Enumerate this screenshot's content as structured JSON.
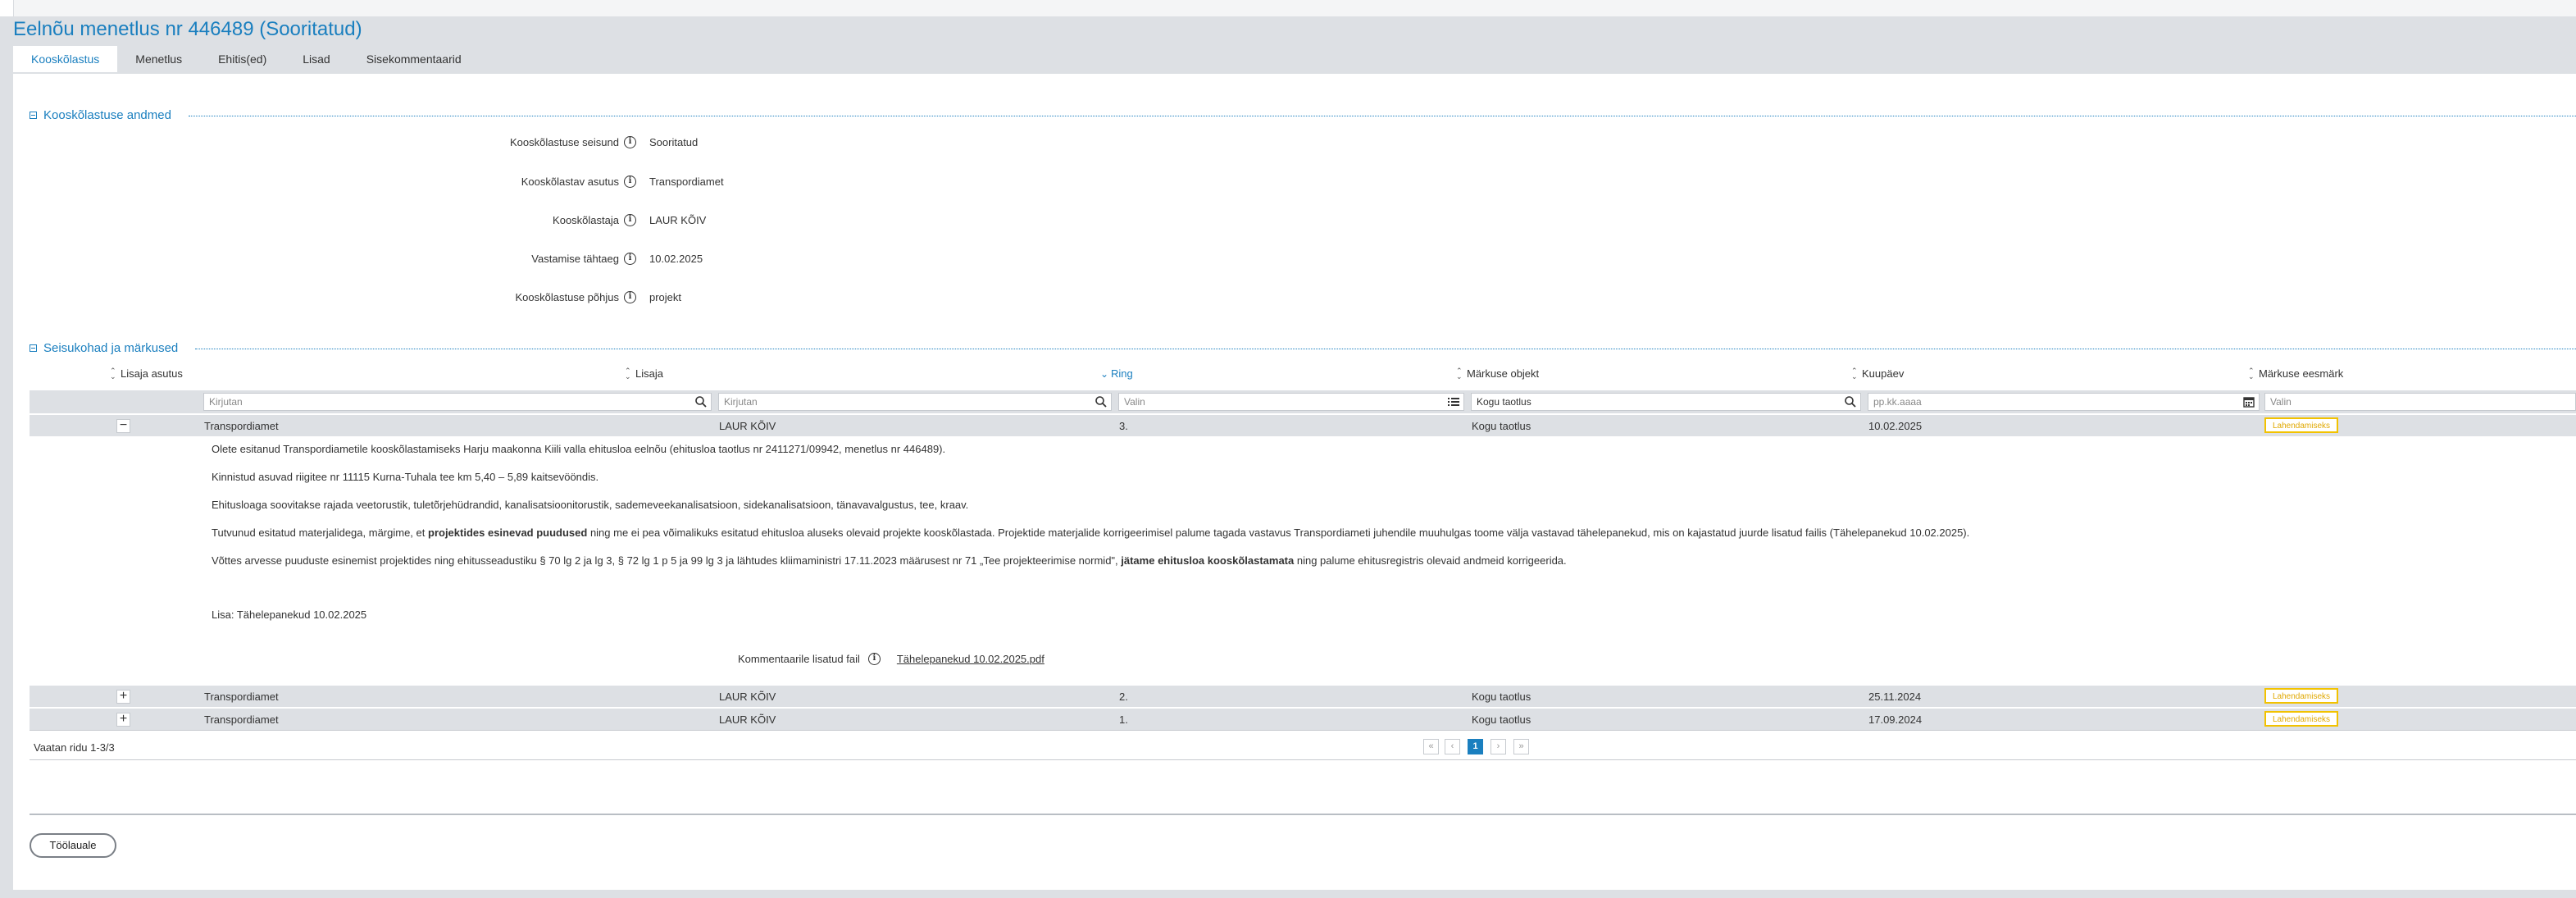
{
  "page": {
    "title": "Eelnõu menetlus nr 446489 (Sooritatud)"
  },
  "tabs": [
    {
      "label": "Kooskõlastus",
      "active": true
    },
    {
      "label": "Menetlus"
    },
    {
      "label": "Ehitis(ed)"
    },
    {
      "label": "Lisad"
    },
    {
      "label": "Sisekommentaarid"
    }
  ],
  "sections": {
    "approval_data_title": "Kooskõlastuse andmed",
    "comments_title": "Seisukohad ja märkused"
  },
  "approval_fields": [
    {
      "label": "Kooskõlastuse seisund",
      "value": "Sooritatud"
    },
    {
      "label": "Kooskõlastav asutus",
      "value": "Transpordiamet"
    },
    {
      "label": "Kooskõlastaja",
      "value": "LAUR KÕIV"
    },
    {
      "label": "Vastamise tähtaeg",
      "value": "10.02.2025"
    },
    {
      "label": "Kooskõlastuse põhjus",
      "value": "projekt"
    }
  ],
  "grid": {
    "columns": [
      "Lisaja asutus",
      "Lisaja",
      "Ring",
      "Märkuse objekt",
      "Kuupäev",
      "Märkuse eesmärk"
    ],
    "filters": {
      "agency_placeholder": "Kirjutan",
      "adder_placeholder": "Kirjutan",
      "round_placeholder": "Valin",
      "object_value": "Kogu taotlus",
      "date_placeholder": "pp.kk.aaaa",
      "purpose_placeholder": "Valin"
    },
    "rows": [
      {
        "agency": "Transpordiamet",
        "adder": "LAUR KÕIV",
        "round": "3.",
        "object": "Kogu taotlus",
        "date": "10.02.2025",
        "purpose": "Lahendamiseks",
        "toggle": "−"
      },
      {
        "agency": "Transpordiamet",
        "adder": "LAUR KÕIV",
        "round": "2.",
        "object": "Kogu taotlus",
        "date": "25.11.2024",
        "purpose": "Lahendamiseks",
        "toggle": "+"
      },
      {
        "agency": "Transpordiamet",
        "adder": "LAUR KÕIV",
        "round": "1.",
        "object": "Kogu taotlus",
        "date": "17.09.2024",
        "purpose": "Lahendamiseks",
        "toggle": "+"
      }
    ],
    "detail": {
      "p1": "Olete esitanud Transpordiametile kooskõlastamiseks Harju maakonna Kiili valla ehitusloa eelnõu (ehitusloa taotlus nr 2411271/09942, menetlus nr 446489).",
      "p2": "Kinnistud asuvad riigitee nr 11115 Kurna-Tuhala tee km 5,40 – 5,89 kaitsevööndis.",
      "p3": "Ehitusloaga soovitakse rajada veetorustik, tuletõrjehüdrandid, kanalisatsioonitorustik, sademeveekanalisatsioon, sidekanalisatsioon, tänavavalgustus, tee, kraav.",
      "p4_a": "Tutvunud esitatud materjalidega, märgime, et ",
      "p4_b": "projektides esinevad puudused",
      "p4_c": " ning me ei pea võimalikuks esitatud ehitusloa aluseks olevaid projekte kooskõlastada. Projektide materjalide korrigeerimisel palume tagada vastavus Transpordiameti juhendile muuhulgas toome välja vastavad tähelepanekud, mis on kajastatud juurde lisatud failis (Tähelepanekud 10.02.2025).",
      "p5_a": "Võttes arvesse puuduste esinemist projektides ning ehitusseadustiku § 70 lg 2 ja lg 3, § 72 lg 1 p 5 ja 99 lg 3 ja lähtudes kliimaministri 17.11.2023 määrusest nr 71 „Tee projekteerimise normid\", ",
      "p5_b": "jätame ehitusloa kooskõlastamata",
      "p5_c": " ning palume ehitusregistris olevaid andmeid korrigeerida.",
      "attachment_note": "Lisa: Tähelepanekud 10.02.2025",
      "file_label": "Kommentaarile lisatud fail",
      "file_name": "Tähelepanekud 10.02.2025.pdf"
    },
    "pager_text": "Vaatan ridu 1-3/3",
    "current_page": "1"
  },
  "buttons": {
    "back": "Töölauale"
  },
  "colors": {
    "accent": "#1a7fbf",
    "badge": "#f2c200",
    "row_bg": "#dde0e4"
  }
}
